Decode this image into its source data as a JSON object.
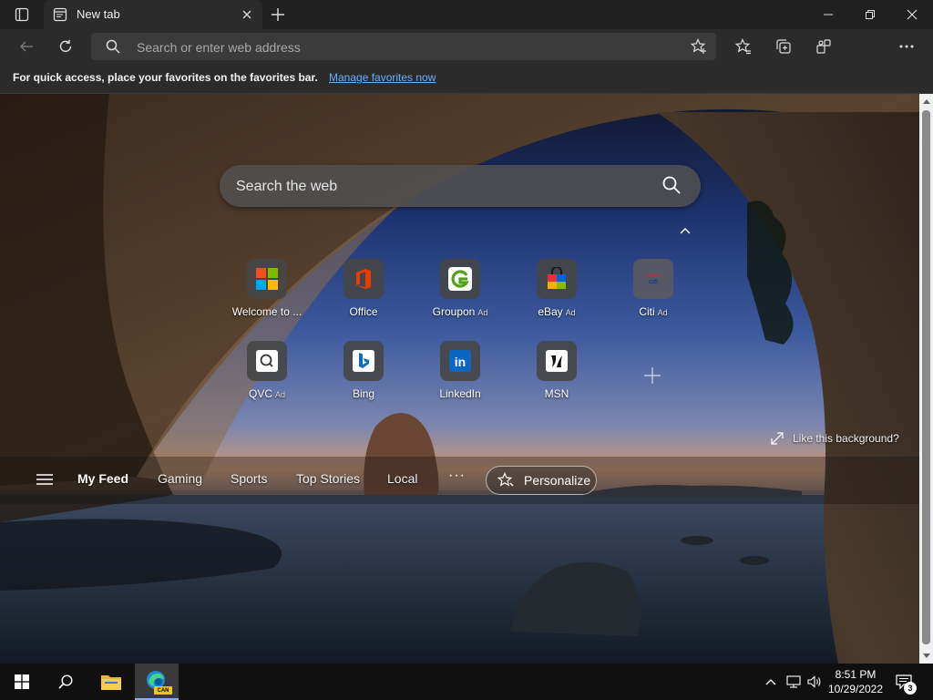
{
  "tab": {
    "title": "New tab"
  },
  "toolbar": {
    "address_placeholder": "Search or enter web address"
  },
  "favorites_bar": {
    "message": "For quick access, place your favorites on the favorites bar.",
    "link": "Manage favorites now"
  },
  "newtab": {
    "search_placeholder": "Search the web",
    "quick_links": [
      {
        "label": "Welcome to ...",
        "ad": "",
        "icon": "microsoft-icon"
      },
      {
        "label": "Office",
        "ad": "",
        "icon": "office-icon"
      },
      {
        "label": "Groupon",
        "ad": "Ad",
        "icon": "groupon-icon"
      },
      {
        "label": "eBay",
        "ad": "Ad",
        "icon": "ebay-icon"
      },
      {
        "label": "Citi",
        "ad": "Ad",
        "icon": "citi-icon"
      },
      {
        "label": "QVC",
        "ad": "Ad",
        "icon": "qvc-icon"
      },
      {
        "label": "Bing",
        "ad": "",
        "icon": "bing-icon"
      },
      {
        "label": "LinkedIn",
        "ad": "",
        "icon": "linkedin-icon"
      },
      {
        "label": "MSN",
        "ad": "",
        "icon": "msn-icon"
      }
    ],
    "like_background": "Like this background?",
    "feed": {
      "items": [
        "My Feed",
        "Gaming",
        "Sports",
        "Top Stories",
        "Local"
      ],
      "active": "My Feed",
      "more": "···",
      "personalize": "Personalize"
    }
  },
  "taskbar": {
    "time": "8:51 PM",
    "date": "10/29/2022",
    "notification_count": "3",
    "edge_badge": "CAN"
  },
  "colors": {
    "accent": "#6ab0ff",
    "chrome": "#2b2b2b",
    "titlebar": "#202020",
    "taskbar": "#101010"
  }
}
